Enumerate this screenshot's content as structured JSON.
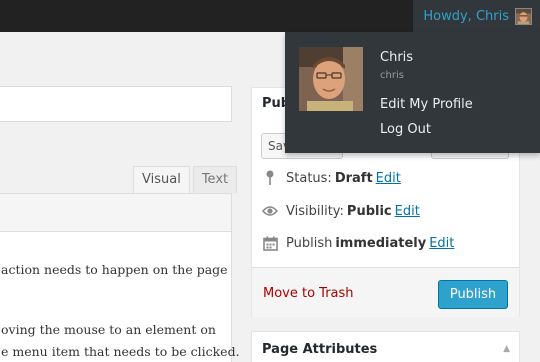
{
  "adminbar": {
    "greeting": "Howdy, Chris",
    "user_menu": {
      "name": "Chris",
      "username": "chris",
      "items": [
        {
          "label": "Edit My Profile"
        },
        {
          "label": "Log Out"
        }
      ]
    }
  },
  "editor": {
    "tabs": [
      {
        "label": "Visual",
        "active": true
      },
      {
        "label": "Text",
        "active": false
      }
    ],
    "content_lines": [
      "action needs to happen on the page",
      "oving the mouse to an element on",
      "e menu item that needs to be clicked."
    ]
  },
  "publish": {
    "title": "Publish",
    "save_draft_label": "Save Draft",
    "status": {
      "label": "Status:",
      "value": "Draft",
      "edit": "Edit"
    },
    "visibility": {
      "label": "Visibility:",
      "value": "Public",
      "edit": "Edit"
    },
    "schedule": {
      "label": "Publish",
      "value": "immediately",
      "edit": "Edit"
    },
    "trash_label": "Move to Trash",
    "publish_label": "Publish"
  },
  "page_attributes": {
    "title": "Page Attributes"
  },
  "colors": {
    "adminbar": "#222222",
    "menu": "#32373c",
    "link": "#0073aa",
    "accent": "#2ea2cc",
    "trash": "#aa0000"
  },
  "icons": [
    "pin-icon",
    "eye-icon",
    "calendar-icon",
    "triangle-up-icon",
    "avatar"
  ]
}
